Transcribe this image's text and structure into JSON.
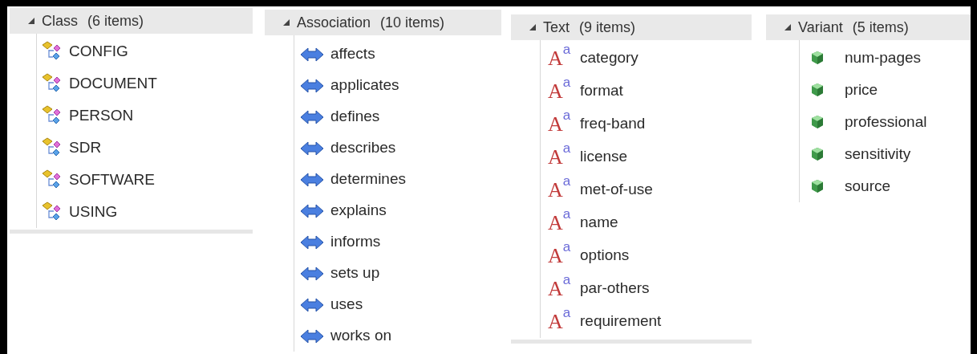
{
  "groups": [
    {
      "kind": "class",
      "title": "Class",
      "count": "(6 items)",
      "expanded": true,
      "items": [
        {
          "label": "CONFIG"
        },
        {
          "label": "DOCUMENT"
        },
        {
          "label": "PERSON"
        },
        {
          "label": "SDR"
        },
        {
          "label": "SOFTWARE"
        },
        {
          "label": "USING"
        }
      ]
    },
    {
      "kind": "association",
      "title": "Association",
      "count": "(10 items)",
      "expanded": true,
      "items": [
        {
          "label": "affects"
        },
        {
          "label": "applicates"
        },
        {
          "label": "defines"
        },
        {
          "label": "describes"
        },
        {
          "label": "determines"
        },
        {
          "label": "explains"
        },
        {
          "label": "informs"
        },
        {
          "label": "sets up"
        },
        {
          "label": "uses"
        },
        {
          "label": "works on"
        }
      ]
    },
    {
      "kind": "text",
      "title": "Text",
      "count": "(9 items)",
      "expanded": true,
      "items": [
        {
          "icon": "A$^{a}$",
          "label": "category"
        },
        {
          "icon": "A$^{a}$",
          "label": "format"
        },
        {
          "icon": "A$^{a}$",
          "label": "freq-band"
        },
        {
          "icon": "A$^{a}$",
          "label": "license"
        },
        {
          "icon": "A$^{a}$",
          "label": "met-of-use"
        },
        {
          "icon": "A$^{a}$",
          "label": "name"
        },
        {
          "icon": "A$^{a}$",
          "label": "options"
        },
        {
          "icon": "A$^{a}$",
          "label": "par-others"
        },
        {
          "icon": "A$^{a}$",
          "label": "requirement"
        }
      ]
    },
    {
      "kind": "variant",
      "title": "Variant",
      "count": "(5 items)",
      "expanded": true,
      "items": [
        {
          "label": "num-pages"
        },
        {
          "label": "price"
        },
        {
          "label": "professional"
        },
        {
          "label": "sensitivity"
        },
        {
          "label": "source"
        }
      ]
    }
  ]
}
